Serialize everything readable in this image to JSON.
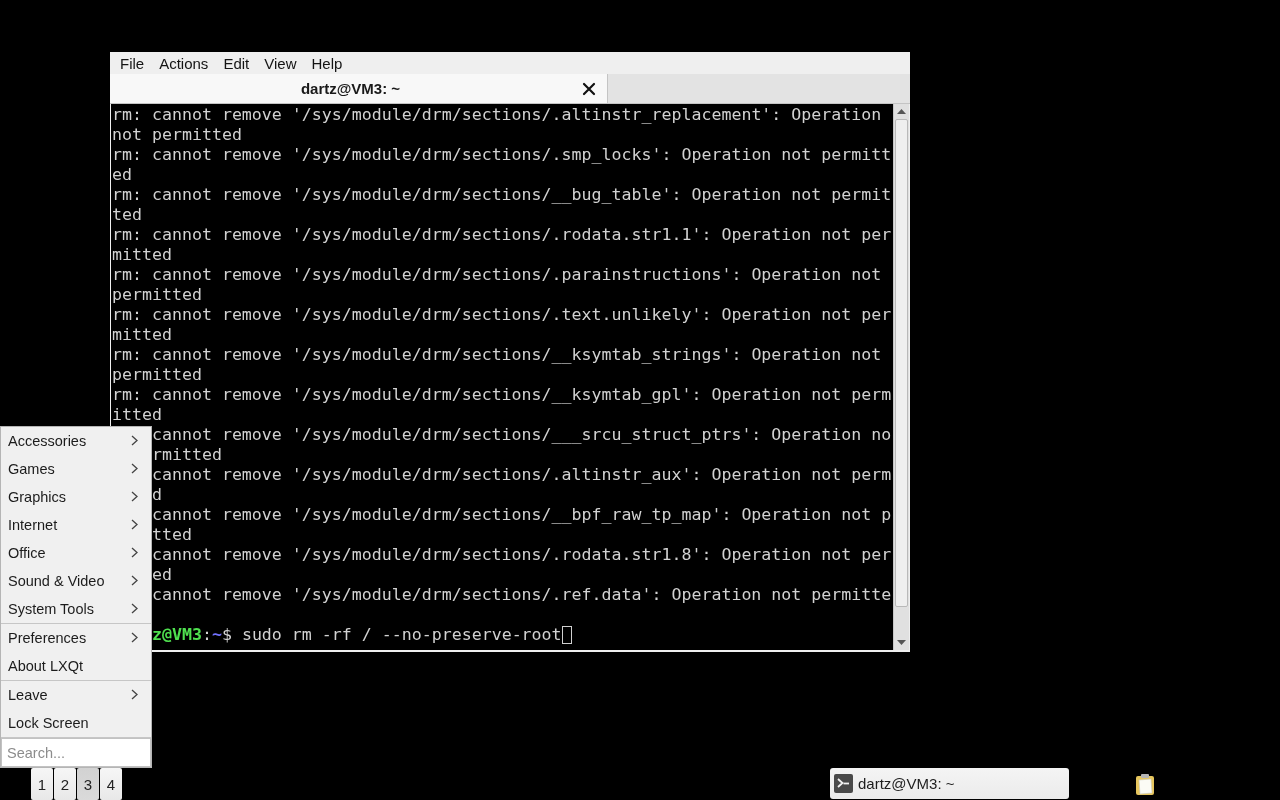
{
  "menu_bar": [
    "File",
    "Actions",
    "Edit",
    "View",
    "Help"
  ],
  "tabs": [
    {
      "label": "dartz@VM3: ~",
      "selected": true
    }
  ],
  "terminal": {
    "lines": [
      "rm: cannot remove '/sys/module/drm/sections/.altinstr_replacement': Operation",
      "not permitted",
      "rm: cannot remove '/sys/module/drm/sections/.smp_locks': Operation not permitt",
      "ed",
      "rm: cannot remove '/sys/module/drm/sections/__bug_table': Operation not permit",
      "ted",
      "rm: cannot remove '/sys/module/drm/sections/.rodata.str1.1': Operation not per",
      "mitted",
      "rm: cannot remove '/sys/module/drm/sections/.parainstructions': Operation not",
      "permitted",
      "rm: cannot remove '/sys/module/drm/sections/.text.unlikely': Operation not per",
      "mitted",
      "rm: cannot remove '/sys/module/drm/sections/__ksymtab_strings': Operation not",
      "permitted",
      "rm: cannot remove '/sys/module/drm/sections/__ksymtab_gpl': Operation not perm",
      "itted"
    ],
    "lines_beside_menu": [
      "cannot remove '/sys/module/drm/sections/___srcu_struct_ptrs': Operation no",
      "rmitted",
      "cannot remove '/sys/module/drm/sections/.altinstr_aux': Operation not perm",
      "d",
      "cannot remove '/sys/module/drm/sections/__bpf_raw_tp_map': Operation not p",
      "tted",
      "cannot remove '/sys/module/drm/sections/.rodata.str1.8': Operation not per",
      "ed",
      "cannot remove '/sys/module/drm/sections/.ref.data': Operation not permitte"
    ],
    "prompt": {
      "user_host": "z@VM3",
      "separator": ":",
      "path": "~",
      "symbol": "$",
      "command": "sudo rm -rf / --no-preserve-root"
    }
  },
  "app_menu": {
    "sections": [
      [
        {
          "label": "Accessories",
          "has_submenu": true
        },
        {
          "label": "Games",
          "has_submenu": true
        },
        {
          "label": "Graphics",
          "has_submenu": true
        },
        {
          "label": "Internet",
          "has_submenu": true
        },
        {
          "label": "Office",
          "has_submenu": true
        },
        {
          "label": "Sound & Video",
          "has_submenu": true
        },
        {
          "label": "System Tools",
          "has_submenu": true
        }
      ],
      [
        {
          "label": "Preferences",
          "has_submenu": true
        },
        {
          "label": "About LXQt",
          "has_submenu": false
        }
      ],
      [
        {
          "label": "Leave",
          "has_submenu": true
        },
        {
          "label": "Lock Screen",
          "has_submenu": false
        }
      ]
    ],
    "search": {
      "placeholder": "Search..."
    }
  },
  "taskbar": {
    "desktops": [
      {
        "label": "1",
        "selected": false
      },
      {
        "label": "2",
        "selected": false
      },
      {
        "label": "3",
        "selected": true
      },
      {
        "label": "4",
        "selected": false
      }
    ],
    "tasks": [
      {
        "label": "dartz@VM3: ~"
      }
    ]
  }
}
